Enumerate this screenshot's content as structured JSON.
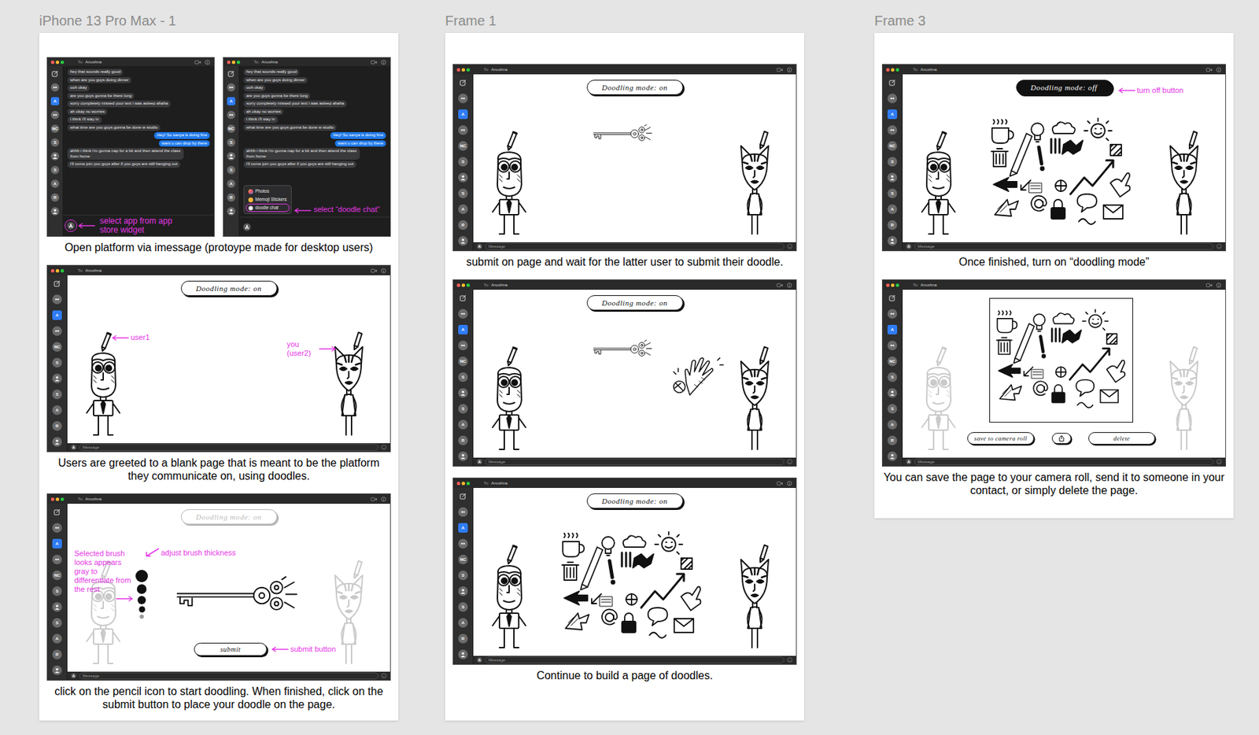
{
  "app": {
    "to": "To:",
    "contact": "Anushna",
    "message_placeholder": "Message",
    "sidebar": [
      {
        "kind": "compose",
        "selected": false
      },
      {
        "kind": "group",
        "selected": false
      },
      {
        "kind": "letter",
        "label": "A",
        "selected": true
      },
      {
        "kind": "group",
        "selected": false
      },
      {
        "kind": "letter",
        "label": "NC",
        "selected": false
      },
      {
        "kind": "letter",
        "label": "S",
        "selected": false
      },
      {
        "kind": "avatar",
        "selected": false
      },
      {
        "kind": "letter",
        "label": "S",
        "selected": false
      },
      {
        "kind": "letter",
        "label": "A",
        "selected": false
      },
      {
        "kind": "letter",
        "label": "R",
        "selected": false
      },
      {
        "kind": "avatar",
        "selected": false
      }
    ],
    "conversation": [
      {
        "text": "hey that sounds really good",
        "mine": false
      },
      {
        "text": "when are you guys doing dinner",
        "mine": false
      },
      {
        "text": "ooh okay",
        "mine": false
      },
      {
        "text": "are you guys gonna be there long",
        "mine": false
      },
      {
        "text": "sorry completely missed your text i was asleep ahaha",
        "mine": false
      },
      {
        "text": "ah okay no worries",
        "mine": false
      },
      {
        "text": "i think i'll stay in",
        "mine": false
      },
      {
        "text": "what time are you guys gonna be done w studio",
        "mine": false
      },
      {
        "text": "Hey! So sanya is doing fine",
        "mine": true
      },
      {
        "text": "want u can drop by there",
        "mine": true
      },
      {
        "text": "ahhh i think i'm gonna nap for a bit and then attend the class from home",
        "mine": false
      },
      {
        "text": "i'll come join you guys after if you guys are still hanging out",
        "mine": false
      }
    ]
  },
  "frames": [
    {
      "title": "iPhone 13 Pro Max - 1",
      "panels": [
        {
          "caption": "Open platform via imessage (protoype made for desktop users)",
          "screens": [
            {
              "kind": "chat",
              "menu": [],
              "note": {
                "text": "select app from app store widget",
                "anchor": "app-store"
              }
            },
            {
              "kind": "chat",
              "menu": [
                {
                  "label": "Photos",
                  "selected": false
                },
                {
                  "label": "Memoji Stickers",
                  "selected": false
                },
                {
                  "label": "doodle chat",
                  "selected": true
                }
              ],
              "note": {
                "text": "select “doodle chat”",
                "anchor": "menu"
              }
            }
          ]
        },
        {
          "caption": "Users are greeted to a blank page that is meant to be the platform they communicate on, using doodles.",
          "screens": [
            {
              "kind": "page",
              "mode": {
                "label": "Doodling mode: on",
                "on": true,
                "disabled": false
              },
              "figures_faded": false,
              "doodles": [],
              "notes": [
                {
                  "text": "user1",
                  "anchor": "left-user"
                },
                {
                  "text": "you (user2)",
                  "anchor": "right-user"
                }
              ]
            }
          ]
        },
        {
          "caption": "click on the pencil icon to start doodling. When finished, click on the submit button to place your doodle on the page.",
          "screens": [
            {
              "kind": "draw",
              "mode": {
                "label": "Doodling mode: on",
                "on": true,
                "disabled": true
              },
              "figures_faded": true,
              "doodles": [
                {
                  "kind": "key"
                }
              ],
              "brushes": [
                {
                  "level": 1,
                  "selected": false
                },
                {
                  "level": 0.8,
                  "selected": false
                },
                {
                  "level": 0.65,
                  "selected": false
                },
                {
                  "level": 0.5,
                  "selected": false
                },
                {
                  "level": 0.32,
                  "selected": true
                }
              ],
              "submit": "submit",
              "notes": [
                {
                  "text": "adjust brush thickness",
                  "anchor": "brushes"
                },
                {
                  "text": "Selected brush looks appears gray to differentiate from the rest",
                  "anchor": "selected-brush"
                },
                {
                  "text": "submit button",
                  "anchor": "submit"
                }
              ]
            }
          ]
        }
      ]
    },
    {
      "title": "Frame 1",
      "panels": [
        {
          "caption": "submit on page and wait for the latter user to submit their doodle.",
          "screens": [
            {
              "kind": "page",
              "mode": {
                "label": "Doodling mode: on",
                "on": true,
                "disabled": false
              },
              "figures_faded": false,
              "doodles": [
                {
                  "kind": "key"
                }
              ],
              "notes": []
            }
          ]
        },
        {
          "screens": [
            {
              "kind": "page",
              "mode": {
                "label": "Doodling mode: on",
                "on": true,
                "disabled": false
              },
              "figures_faded": false,
              "doodles": [
                {
                  "kind": "key"
                },
                {
                  "kind": "hand"
                }
              ],
              "notes": []
            }
          ]
        },
        {
          "caption": "Continue to build a page of doodles.",
          "screens": [
            {
              "kind": "page",
              "mode": {
                "label": "Doodling mode: on",
                "on": true,
                "disabled": false
              },
              "figures_faded": false,
              "doodles": [
                {
                  "kind": "collage"
                }
              ],
              "notes": []
            }
          ]
        }
      ]
    },
    {
      "title": "Frame 3",
      "panels": [
        {
          "caption": "Once finished, turn on “doodling mode”",
          "screens": [
            {
              "kind": "page",
              "mode": {
                "label": "Doodling mode: off",
                "on": false,
                "disabled": false
              },
              "figures_faded": false,
              "doodles": [
                {
                  "kind": "collage"
                }
              ],
              "notes": [
                {
                  "text": "turn off button",
                  "anchor": "mode"
                }
              ]
            }
          ]
        },
        {
          "caption": "You can save the page to your camera roll, send it to someone in your contact, or simply delete the page.",
          "screens": [
            {
              "kind": "export",
              "figures_faded": true,
              "doodles": [
                {
                  "kind": "collage"
                }
              ],
              "actions": [
                {
                  "kind": "text",
                  "label": "save to camera roll"
                },
                {
                  "kind": "share"
                },
                {
                  "kind": "text",
                  "label": "delete"
                }
              ],
              "notes": []
            }
          ]
        }
      ]
    }
  ]
}
